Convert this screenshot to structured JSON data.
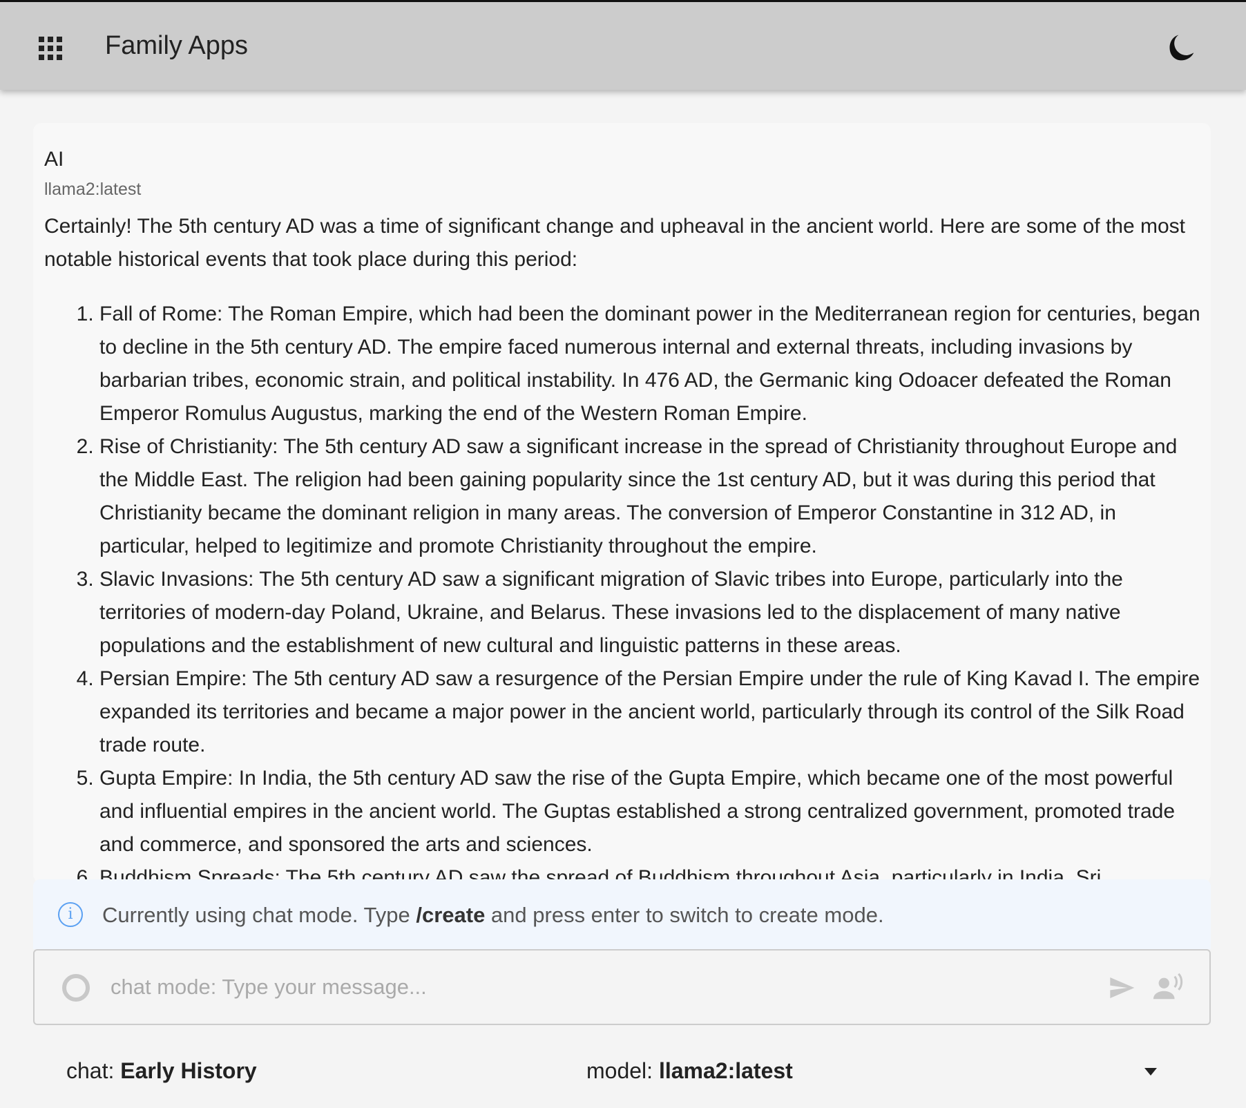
{
  "header": {
    "title": "Family Apps",
    "apps_icon": "apps-grid-icon",
    "theme_icon": "moon-icon"
  },
  "message": {
    "sender": "AI",
    "model": "llama2:latest",
    "intro": "Certainly! The 5th century AD was a time of significant change and upheaval in the ancient world. Here are some of the most notable historical events that took place during this period:",
    "items": [
      "Fall of Rome: The Roman Empire, which had been the dominant power in the Mediterranean region for centuries, began to decline in the 5th century AD. The empire faced numerous internal and external threats, including invasions by barbarian tribes, economic strain, and political instability. In 476 AD, the Germanic king Odoacer defeated the Roman Emperor Romulus Augustus, marking the end of the Western Roman Empire.",
      "Rise of Christianity: The 5th century AD saw a significant increase in the spread of Christianity throughout Europe and the Middle East. The religion had been gaining popularity since the 1st century AD, but it was during this period that Christianity became the dominant religion in many areas. The conversion of Emperor Constantine in 312 AD, in particular, helped to legitimize and promote Christianity throughout the empire.",
      "Slavic Invasions: The 5th century AD saw a significant migration of Slavic tribes into Europe, particularly into the territories of modern-day Poland, Ukraine, and Belarus. These invasions led to the displacement of many native populations and the establishment of new cultural and linguistic patterns in these areas.",
      "Persian Empire: The 5th century AD saw a resurgence of the Persian Empire under the rule of King Kavad I. The empire expanded its territories and became a major power in the ancient world, particularly through its control of the Silk Road trade route.",
      "Gupta Empire: In India, the 5th century AD saw the rise of the Gupta Empire, which became one of the most powerful and influential empires in the ancient world. The Guptas established a strong centralized government, promoted trade and commerce, and sponsored the arts and sciences.",
      "Buddhism Spreads: The 5th century AD saw the spread of Buddhism throughout Asia, particularly in India, Sri"
    ]
  },
  "info": {
    "prefix": "Currently using chat mode. Type ",
    "command": "/create",
    "suffix": " and press enter to switch to create mode.",
    "icon": "info-icon",
    "color": "#5aa0f2"
  },
  "composer": {
    "placeholder": "chat mode: Type your message...",
    "attach_icon": "camera-aperture-icon",
    "send_icon": "send-icon",
    "voice_icon": "voice-icon"
  },
  "footer": {
    "chat_label": "chat: ",
    "chat_value": "Early History",
    "model_label": "model: ",
    "model_value": "llama2:latest"
  }
}
